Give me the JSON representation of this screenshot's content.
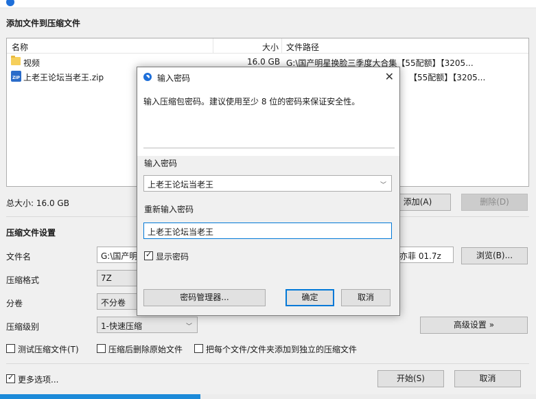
{
  "main": {
    "add_files_title": "添加文件到压缩文件",
    "columns": [
      "名称",
      "大小",
      "文件路径"
    ],
    "files": [
      {
        "name": "视频",
        "size": "16.0 GB",
        "path": "G:\\国产明星换脸三季度大合集【55配额】【3205...",
        "icon": "folder-icon"
      },
      {
        "name": "上老王论坛当老王.zip",
        "size": "",
        "path": "【55配额】【3205...",
        "icon": "zip-icon"
      }
    ],
    "total_size": "总大小: 16.0 GB",
    "add_button": "添加(A)",
    "delete_button": "删除(D)",
    "settings_title": "压缩文件设置",
    "filename_label": "文件名",
    "filename_value": "G:\\国产明",
    "filename_tail": "亦菲 01.7z",
    "browse_button": "浏览(B)...",
    "format_label": "压缩格式",
    "format_value": "7Z",
    "split_label": "分卷",
    "split_value": "不分卷",
    "level_label": "压缩级别",
    "level_value": "1-快速压缩",
    "advanced_button": "高级设置 »",
    "test_archive": "测试压缩文件(T)",
    "delete_after": "压缩后删除原始文件",
    "each_separate": "把每个文件/文件夹添加到独立的压缩文件",
    "more_options": "更多选项...",
    "start_button": "开始(S)",
    "cancel_button": "取消"
  },
  "dialog": {
    "title": "输入密码",
    "description": "输入压缩包密码。建议使用至少 8 位的密码来保证安全性。",
    "password_label": "输入密码",
    "password_value": "上老王论坛当老王",
    "confirm_label": "重新输入密码",
    "confirm_value": "上老王论坛当老王",
    "show_password": "显示密码",
    "manager_button": "密码管理器...",
    "ok_button": "确定",
    "cancel_button": "取消"
  }
}
